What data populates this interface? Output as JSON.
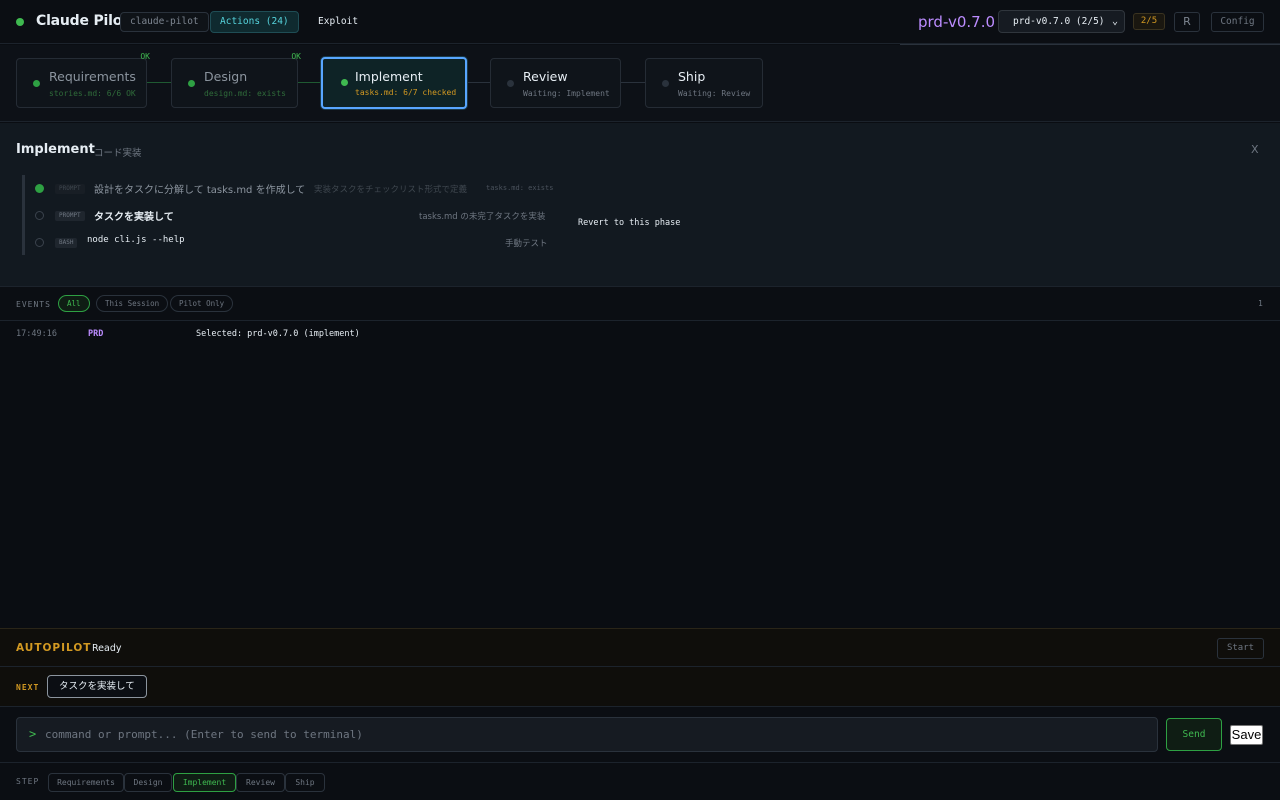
{
  "header": {
    "title": "Claude Pilot",
    "repo": "claude-pilot",
    "actions": "Actions (24)",
    "exploit": "Exploit",
    "version": "prd-v0.7.0",
    "version_select": "prd-v0.7.0 (2/5)",
    "progress": "2/5",
    "reload": "R",
    "config": "Config"
  },
  "phases": [
    {
      "name": "Requirements",
      "status": "stories.md: 6/6 OK",
      "badge": "OK"
    },
    {
      "name": "Design",
      "status": "design.md: exists",
      "badge": "OK"
    },
    {
      "name": "Implement",
      "status": "tasks.md: 6/7 checked"
    },
    {
      "name": "Review",
      "status": "Waiting: Implement"
    },
    {
      "name": "Ship",
      "status": "Waiting: Review"
    }
  ],
  "detail": {
    "title": "Implement",
    "subtitle": "コード実装",
    "close": "X",
    "revert": "Revert to this phase",
    "steps": [
      {
        "tag": "PROMPT",
        "text": "設計をタスクに分解して tasks.md を作成して",
        "desc": "実装タスクをチェックリスト形式で定義",
        "extra": "tasks.md: exists"
      },
      {
        "tag": "PROMPT",
        "text": "タスクを実装して",
        "desc": "tasks.md の未完了タスクを実装"
      },
      {
        "tag": "BASH",
        "text": "node cli.js --help",
        "desc": "手動テスト"
      }
    ]
  },
  "events": {
    "label": "EVENTS",
    "filters": [
      "All",
      "This Session",
      "Pilot Only"
    ],
    "count": "1",
    "rows": [
      {
        "time": "17:49:16",
        "source": "PRD",
        "message": "Selected: prd-v0.7.0 (implement)"
      }
    ]
  },
  "autopilot": {
    "label": "AUTOPILOT",
    "status": "Ready",
    "start": "Start"
  },
  "next": {
    "label": "NEXT",
    "action": "タスクを実装して"
  },
  "command": {
    "prompt": ">",
    "placeholder": "command or prompt... (Enter to send to terminal)",
    "send": "Send",
    "save": "Save"
  },
  "stepbar": {
    "label": "STEP",
    "items": [
      "Requirements",
      "Design",
      "Implement",
      "Review",
      "Ship"
    ],
    "active": "Implement"
  },
  "colors": {
    "accent_green": "#3fb950",
    "accent_purple": "#bc8cff",
    "accent_orange": "#d29922",
    "accent_blue": "#58a6ff",
    "background": "#0a0d12"
  }
}
